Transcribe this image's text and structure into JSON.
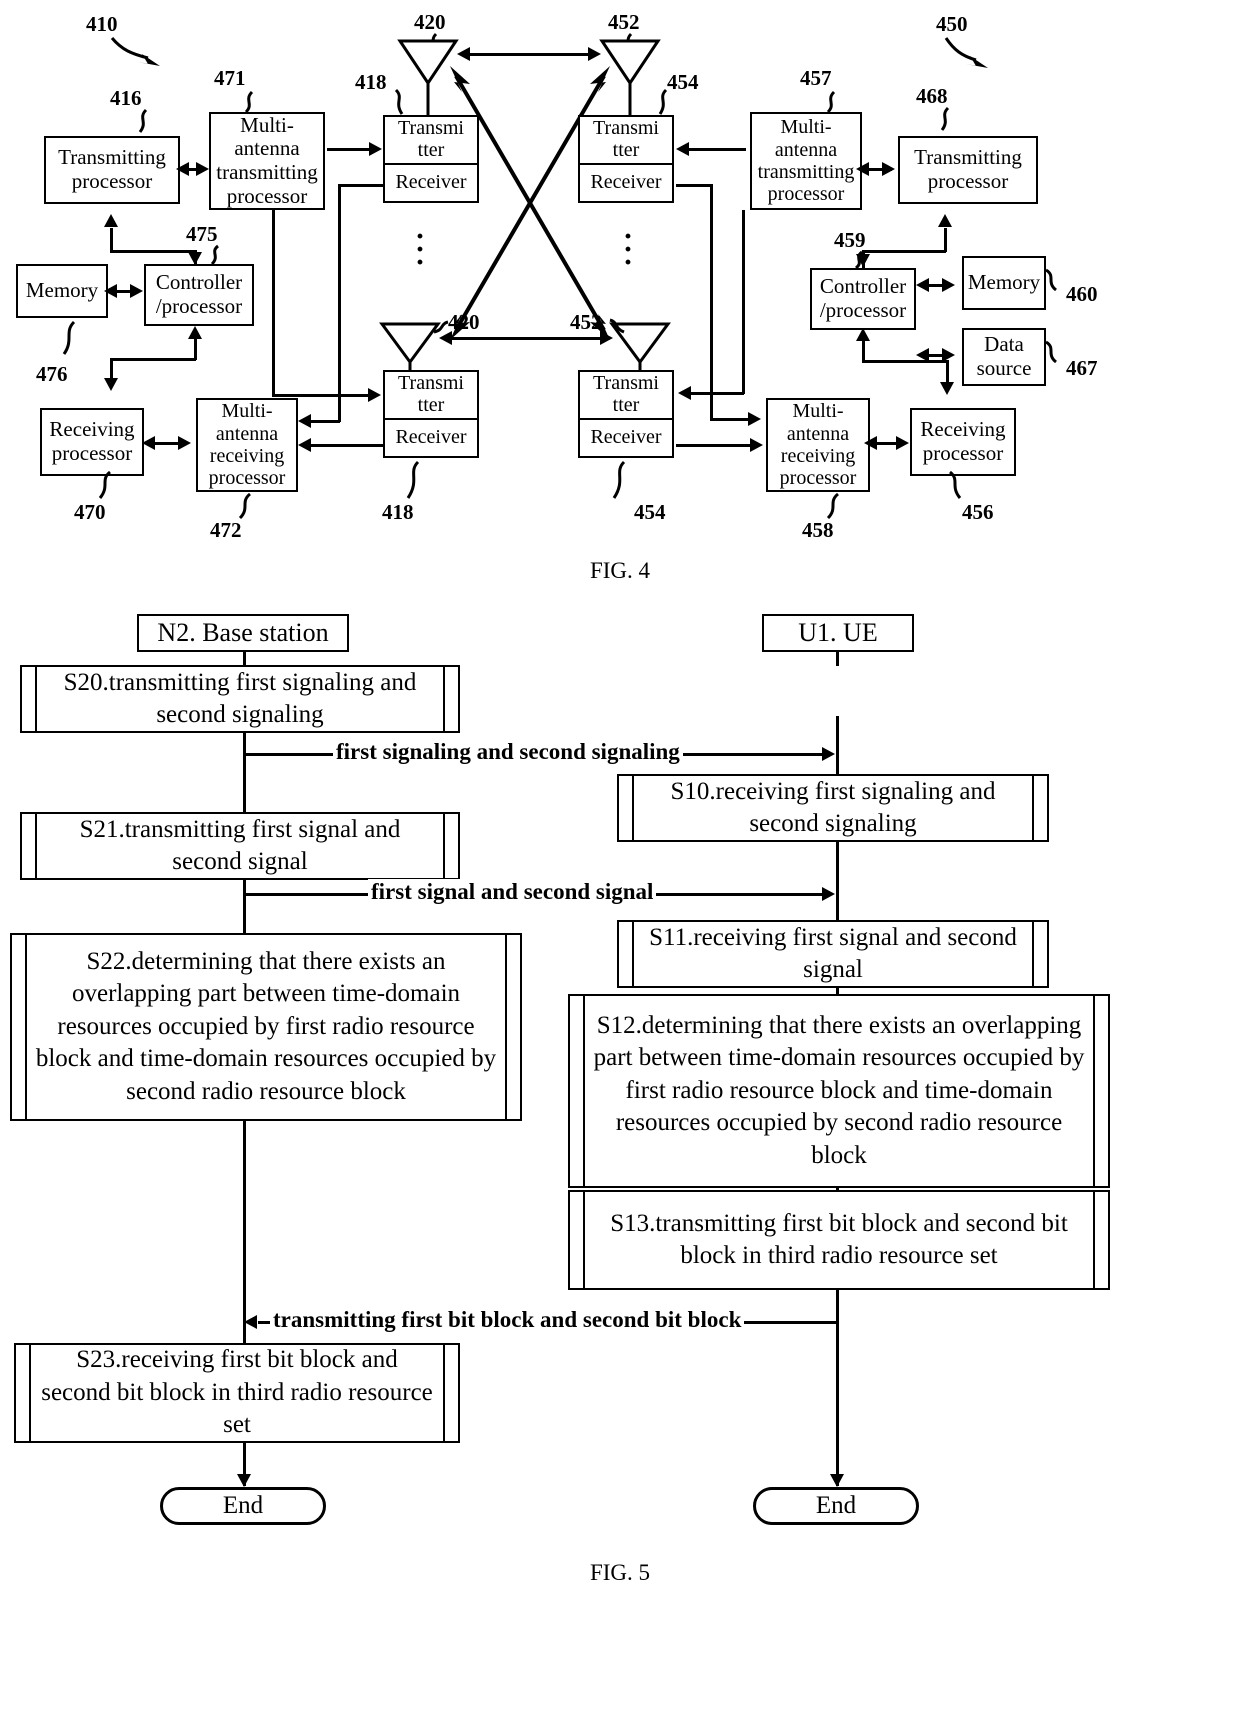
{
  "figures": [
    {
      "id": "fig4",
      "caption": "FIG. 4"
    },
    {
      "id": "fig5",
      "caption": "FIG. 5"
    }
  ],
  "fig4": {
    "caption": "FIG. 4",
    "left_system_ref": "410",
    "right_system_ref": "450",
    "blocks": {
      "tx_processor_left": "Transmitting processor",
      "multi_antenna_tx_left_l1": "Multi-",
      "multi_antenna_tx_left_l2": "antenna",
      "multi_antenna_tx_left_l3": "transmitting",
      "multi_antenna_tx_left_l4": "processor",
      "transmitter": "Transmi tter",
      "transmitter_l1": "Transmi",
      "transmitter_l2": "tter",
      "receiver": "Receiver",
      "memory": "Memory",
      "controller_l1": "Controller",
      "controller_l2": "/processor",
      "rx_processor": "Receiving processor",
      "multi_antenna_rx_l1": "Multi-",
      "multi_antenna_rx_l2": "antenna",
      "multi_antenna_rx_l3": "receiving",
      "multi_antenna_rx_l4": "processor",
      "data_source_l1": "Data",
      "data_source_l2": "source"
    },
    "refs": {
      "r410": "410",
      "r416": "416",
      "r418_top": "418",
      "r418_bottom": "418",
      "r420_top": "420",
      "r420_bottom": "420",
      "r450": "450",
      "r452_top": "452",
      "r452_bottom": "452",
      "r454_top": "454",
      "r454_bottom": "454",
      "r456": "456",
      "r457": "457",
      "r458": "458",
      "r459": "459",
      "r460": "460",
      "r467": "467",
      "r468": "468",
      "r470": "470",
      "r471": "471",
      "r472": "472",
      "r475": "475",
      "r476": "476"
    }
  },
  "fig5": {
    "caption": "FIG. 5",
    "lifelines": {
      "left_title": "N2. Base station",
      "right_title": "U1. UE"
    },
    "left_steps": [
      {
        "id": "S20",
        "text": "S20.transmitting first signaling and second signaling"
      },
      {
        "id": "S21",
        "text": "S21.transmitting first signal and second signal"
      },
      {
        "id": "S22",
        "text": "S22.determining that there exists an overlapping part between time-domain resources occupied by first radio resource block and time-domain resources occupied by second radio resource block"
      },
      {
        "id": "S23",
        "text": "S23.receiving first bit block and second bit block in third radio resource set"
      }
    ],
    "right_steps": [
      {
        "id": "S10",
        "text": "S10.receiving first signaling and second signaling"
      },
      {
        "id": "S11",
        "text": "S11.receiving first signal and second signal"
      },
      {
        "id": "S12",
        "text": "S12.determining that there exists an overlapping part between time-domain resources occupied by first radio resource block and time-domain resources occupied by second radio resource block"
      },
      {
        "id": "S13",
        "text": "S13.transmitting first bit block and second bit block in third radio resource set"
      }
    ],
    "messages": [
      {
        "id": "m1",
        "text": "first signaling and second signaling",
        "direction": "right"
      },
      {
        "id": "m2",
        "text": "first signal and second signal",
        "direction": "right"
      },
      {
        "id": "m3",
        "text": "transmitting first bit block and second bit block",
        "direction": "left"
      }
    ],
    "end_left": "End",
    "end_right": "End"
  }
}
